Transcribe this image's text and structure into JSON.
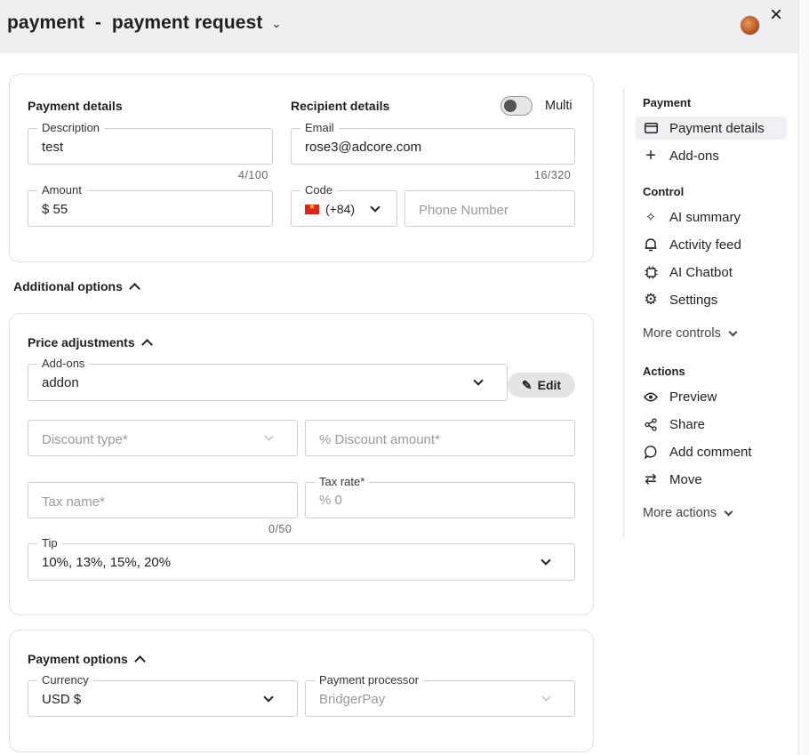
{
  "header": {
    "title": "payment  -  payment request",
    "close": "×"
  },
  "payment_details": {
    "title": "Payment details",
    "description": {
      "label": "Description",
      "value": "test",
      "counter": "4/100"
    },
    "amount": {
      "label": "Amount",
      "value": "$ 55"
    }
  },
  "recipient": {
    "title": "Recipient details",
    "multi_label": "Multi",
    "email": {
      "label": "Email",
      "value": "rose3@adcore.com",
      "counter": "16/320"
    },
    "code": {
      "label": "Code",
      "value": "(+84)"
    },
    "phone": {
      "placeholder": "Phone Number"
    }
  },
  "additional_options": {
    "title": "Additional options"
  },
  "price_adjustments": {
    "title": "Price adjustments",
    "addons": {
      "label": "Add-ons",
      "value": "addon"
    },
    "edit_label": "Edit",
    "discount_type": {
      "placeholder": "Discount type*"
    },
    "discount_amount": {
      "placeholder": "% Discount amount*"
    },
    "tax_name": {
      "placeholder": "Tax name*",
      "counter": "0/50"
    },
    "tax_rate": {
      "label": "Tax rate*",
      "placeholder": "% 0"
    },
    "tip": {
      "label": "Tip",
      "value": "10%, 13%, 15%, 20%"
    }
  },
  "payment_options": {
    "title": "Payment options",
    "currency": {
      "label": "Currency",
      "value": "USD $"
    },
    "processor": {
      "label": "Payment processor",
      "value": "BridgerPay"
    }
  },
  "nav": {
    "payment_heading": "Payment",
    "payment_items": [
      {
        "label": "Payment details",
        "icon": "card-icon"
      },
      {
        "label": "Add-ons",
        "icon": "plus-icon"
      }
    ],
    "control_heading": "Control",
    "control_items": [
      {
        "label": "AI summary",
        "icon": "sparkle-icon"
      },
      {
        "label": "Activity feed",
        "icon": "bell-icon"
      },
      {
        "label": "AI Chatbot",
        "icon": "chip-icon"
      },
      {
        "label": "Settings",
        "icon": "gear-icon"
      }
    ],
    "more_controls": "More controls",
    "actions_heading": "Actions",
    "action_items": [
      {
        "label": "Preview",
        "icon": "eye-icon"
      },
      {
        "label": "Share",
        "icon": "share-icon"
      },
      {
        "label": "Add comment",
        "icon": "comment-icon"
      },
      {
        "label": "Move",
        "icon": "move-icon"
      }
    ],
    "more_actions": "More actions"
  }
}
